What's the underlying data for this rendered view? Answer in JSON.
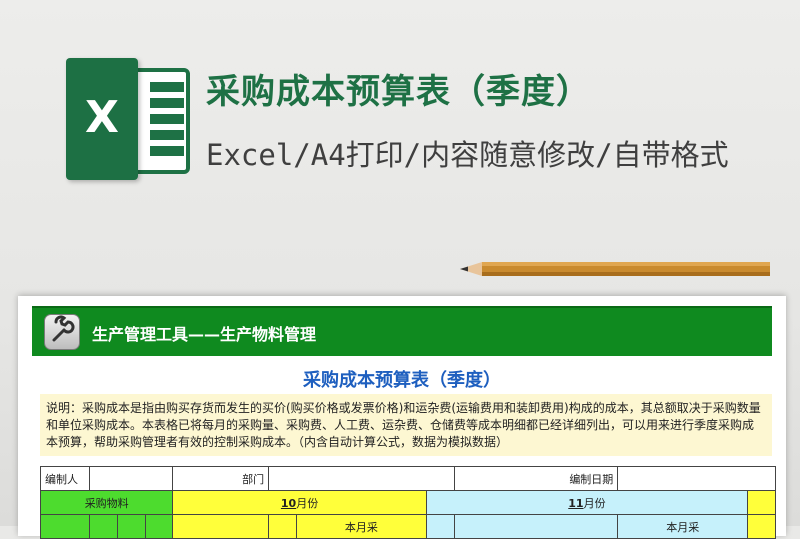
{
  "header": {
    "title": "采购成本预算表（季度）",
    "subtitle": "Excel/A4打印/内容随意修改/自带格式"
  },
  "logo": {
    "letter": "X",
    "icon": "excel-logo-icon",
    "color": "#1e7145"
  },
  "sheet": {
    "banner_text": "生产管理工具——生产物料管理",
    "banner_icon": "wrench-icon",
    "banner_color": "#0f8a1f",
    "title": "采购成本预算表（季度）",
    "desc_lines": [
      "说明：采购成本是指由购买存货而发生的买价(购买价格或发票价格)和运杂费(运输费用和装卸费用)构成的成本，其总额取决于采购数量",
      "和单位采购成本。本表格已将每月的采购量、采购费、人工费、运杂费、仓储费等成本明细都已经详细列出，可以用来进行季度采购成",
      "本预算，帮助采购管理者有效的控制采购成本。（内含自动计算公式，数据为模拟数据）"
    ],
    "form": {
      "editor_label": "编制人",
      "dept_label": "部门",
      "date_label": "编制日期"
    },
    "groups": {
      "materials": "采购物料",
      "month1_num": "10",
      "month2_num": "11",
      "month_suffix": "月份",
      "partial_label": "本月采"
    }
  }
}
